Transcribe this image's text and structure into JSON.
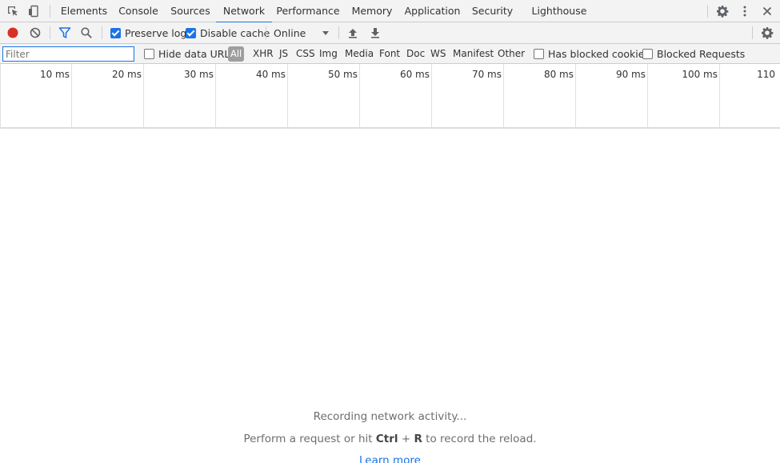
{
  "tabs": [
    "Elements",
    "Console",
    "Sources",
    "Network",
    "Performance",
    "Memory",
    "Application",
    "Security",
    "Lighthouse"
  ],
  "active_tab": "Network",
  "toolbar": {
    "preserve_log": {
      "label": "Preserve log",
      "checked": true
    },
    "disable_cache": {
      "label": "Disable cache",
      "checked": true
    },
    "throttling": "Online"
  },
  "filter": {
    "placeholder": "Filter",
    "hide_data_urls": {
      "label": "Hide data URLs",
      "checked": false
    },
    "types": [
      "All",
      "XHR",
      "JS",
      "CSS",
      "Img",
      "Media",
      "Font",
      "Doc",
      "WS",
      "Manifest",
      "Other"
    ],
    "active_type": "All",
    "has_blocked_cookies": {
      "label": "Has blocked cookies",
      "checked": false
    },
    "blocked_requests": {
      "label": "Blocked Requests",
      "checked": false
    }
  },
  "timeline_ticks": [
    "10 ms",
    "20 ms",
    "30 ms",
    "40 ms",
    "50 ms",
    "60 ms",
    "70 ms",
    "80 ms",
    "90 ms",
    "100 ms",
    "110"
  ],
  "empty_state": {
    "line1": "Recording network activity...",
    "line2_before": "Perform a request or hit ",
    "line2_key1": "Ctrl",
    "line2_plus": " + ",
    "line2_key2": "R",
    "line2_after": " to record the reload.",
    "link": "Learn more"
  },
  "colors": {
    "accent": "#1a73e8",
    "record": "#d93025",
    "toolbar_bg": "#f3f3f3"
  }
}
